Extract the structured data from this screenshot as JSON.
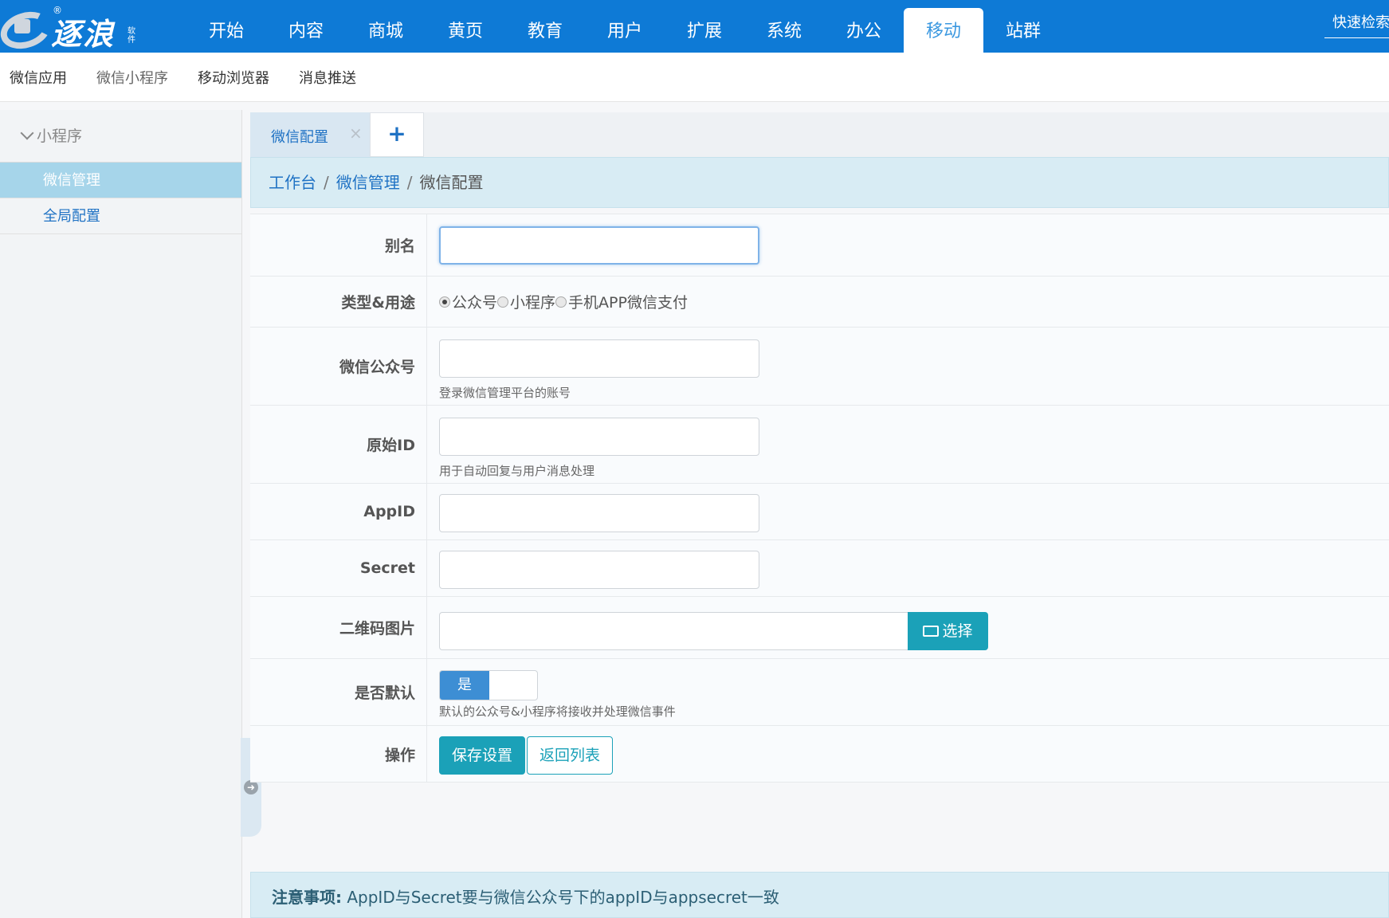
{
  "logo": {
    "name": "逐浪",
    "reg_mark": "®",
    "tagline": "软件"
  },
  "topnav": {
    "items": [
      "开始",
      "内容",
      "商城",
      "黄页",
      "教育",
      "用户",
      "扩展",
      "系统",
      "办公",
      "移动",
      "站群"
    ],
    "active_index": 9
  },
  "quick_search": "快速检索",
  "subnav": {
    "items": [
      "微信应用",
      "微信小程序",
      "移动浏览器",
      "消息推送"
    ]
  },
  "sidebar": {
    "group": "小程序",
    "items": [
      {
        "label": "微信管理",
        "active": true
      },
      {
        "label": "全局配置",
        "active": false
      }
    ]
  },
  "tabs": {
    "items": [
      {
        "label": "微信配置",
        "close": "×"
      }
    ],
    "add": "+"
  },
  "breadcrumb": {
    "items": [
      "工作台",
      "微信管理"
    ],
    "separator": "/",
    "current": "微信配置"
  },
  "form": {
    "alias": {
      "label": "别名",
      "value": ""
    },
    "type": {
      "label": "类型&用途",
      "options": [
        "公众号",
        "小程序",
        "手机APP微信支付"
      ],
      "selected_index": 0
    },
    "wechat_account": {
      "label": "微信公众号",
      "value": "",
      "help": "登录微信管理平台的账号"
    },
    "original_id": {
      "label": "原始ID",
      "value": "",
      "help": "用于自动回复与用户消息处理"
    },
    "appid": {
      "label": "AppID",
      "value": ""
    },
    "secret": {
      "label": "Secret",
      "value": ""
    },
    "qrcode": {
      "label": "二维码图片",
      "value": "",
      "button": "选择"
    },
    "is_default": {
      "label": "是否默认",
      "toggle_on_label": "是",
      "value": true,
      "help": "默认的公众号&小程序将接收并处理微信事件"
    },
    "actions": {
      "label": "操作",
      "save": "保存设置",
      "back": "返回列表"
    }
  },
  "notice": {
    "title": "注意事项:",
    "text": " AppID与Secret要与微信公众号下的appID与appsecret一致"
  },
  "colors": {
    "topbar": "#0e7ad6",
    "accent": "#1ba1b8",
    "link": "#1f72c4",
    "sidebar_active": "#a6d5ea"
  }
}
